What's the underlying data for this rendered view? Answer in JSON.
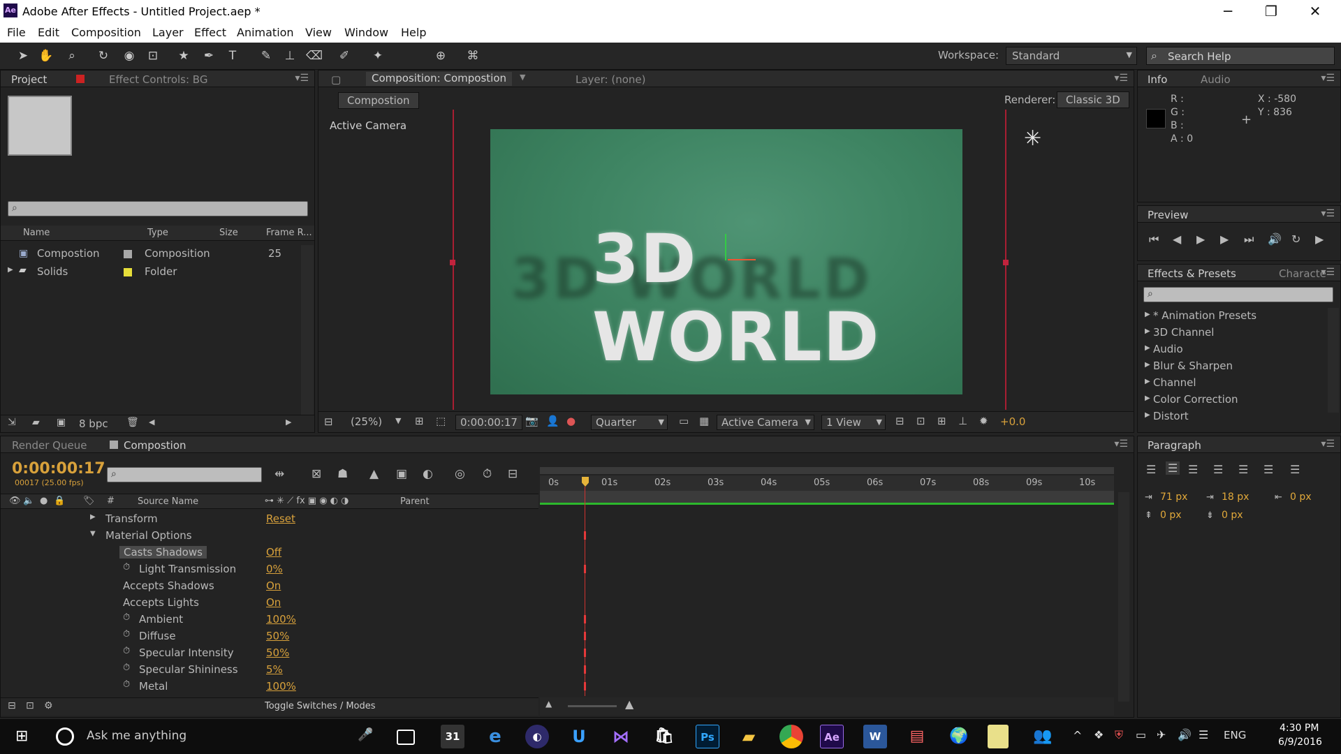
{
  "window": {
    "title": "Adobe After Effects - Untitled Project.aep *",
    "min": "─",
    "max": "❐",
    "close": "✕",
    "app_icon": "Ae"
  },
  "menu": [
    "File",
    "Edit",
    "Composition",
    "Layer",
    "Effect",
    "Animation",
    "View",
    "Window",
    "Help"
  ],
  "toolbar": {
    "workspace_label": "Workspace:",
    "workspace_value": "Standard",
    "search_placeholder": "Search Help"
  },
  "project": {
    "tab": "Project",
    "tab2": "Effect Controls: BG",
    "columns": [
      "Name",
      "Type",
      "Size",
      "Frame R..."
    ],
    "items": [
      {
        "name": "Compostion",
        "type": "Composition",
        "fr": "25"
      },
      {
        "name": "Solids",
        "type": "Folder",
        "fr": ""
      }
    ],
    "bpc": "8 bpc"
  },
  "comp_viewer": {
    "tab": "Composition: Compostion",
    "layer_tab": "Layer: (none)",
    "sub_tab": "Compostion",
    "renderer_label": "Renderer:",
    "renderer_value": "Classic 3D",
    "camera_label": "Active Camera",
    "headline": "3D WORLD",
    "bottom": {
      "zoom": "(25%)",
      "time": "0:00:00:17",
      "resolution": "Quarter",
      "camera": "Active Camera",
      "views": "1 View",
      "exposure": "+0.0"
    }
  },
  "info": {
    "tab": "Info",
    "tab2": "Audio",
    "r": "R :",
    "g": "G :",
    "b": "B :",
    "a": "A : 0",
    "x": "X : -580",
    "y": "Y : 836"
  },
  "preview": {
    "tab": "Preview"
  },
  "effects": {
    "tab": "Effects & Presets",
    "tab2": "Characte",
    "items": [
      "* Animation Presets",
      "3D Channel",
      "Audio",
      "Blur & Sharpen",
      "Channel",
      "Color Correction",
      "Distort"
    ]
  },
  "paragraph": {
    "tab": "Paragraph",
    "v1": "71 px",
    "v2": "18 px",
    "v3": "0 px",
    "v4": "0 px",
    "v5": "0 px"
  },
  "timeline": {
    "tab1": "Render Queue",
    "tab2": "Compostion",
    "timecode": "0:00:00:17",
    "fps": "00017 (25.00 fps)",
    "source_name": "Source Name",
    "parent": "Parent",
    "toggle": "Toggle Switches / Modes",
    "ruler": [
      "0s",
      "01s",
      "02s",
      "03s",
      "04s",
      "05s",
      "06s",
      "07s",
      "08s",
      "09s",
      "10s"
    ],
    "props": [
      {
        "name": "Transform",
        "value": "Reset",
        "indent": 0,
        "twirl": "▶",
        "stopwatch": false,
        "key": false
      },
      {
        "name": "Material Options",
        "value": "",
        "indent": 0,
        "twirl": "▼",
        "stopwatch": false,
        "key": true
      },
      {
        "name": "Casts Shadows",
        "value": "Off",
        "indent": 1,
        "twirl": "",
        "stopwatch": false,
        "key": false,
        "selected": true
      },
      {
        "name": "Light Transmission",
        "value": "0%",
        "indent": 1,
        "twirl": "",
        "stopwatch": true,
        "key": true
      },
      {
        "name": "Accepts Shadows",
        "value": "On",
        "indent": 1,
        "twirl": "",
        "stopwatch": false,
        "key": false
      },
      {
        "name": "Accepts Lights",
        "value": "On",
        "indent": 1,
        "twirl": "",
        "stopwatch": false,
        "key": false
      },
      {
        "name": "Ambient",
        "value": "100%",
        "indent": 1,
        "twirl": "",
        "stopwatch": true,
        "key": true
      },
      {
        "name": "Diffuse",
        "value": "50%",
        "indent": 1,
        "twirl": "",
        "stopwatch": true,
        "key": true
      },
      {
        "name": "Specular Intensity",
        "value": "50%",
        "indent": 1,
        "twirl": "",
        "stopwatch": true,
        "key": true
      },
      {
        "name": "Specular Shininess",
        "value": "5%",
        "indent": 1,
        "twirl": "",
        "stopwatch": true,
        "key": true
      },
      {
        "name": "Metal",
        "value": "100%",
        "indent": 1,
        "twirl": "",
        "stopwatch": true,
        "key": true
      }
    ]
  },
  "taskbar": {
    "search": "Ask me anything",
    "time": "4:30 PM",
    "date": "6/9/2016",
    "lang": "ENG",
    "apps": [
      "Task View",
      "Calendar",
      "Edge",
      "Eclipse",
      "Unity",
      "Visual Studio",
      "Store",
      "Photoshop",
      "Explorer",
      "Chrome",
      "After Effects",
      "Word",
      "Media",
      "Maps",
      "Notes",
      "People"
    ]
  }
}
